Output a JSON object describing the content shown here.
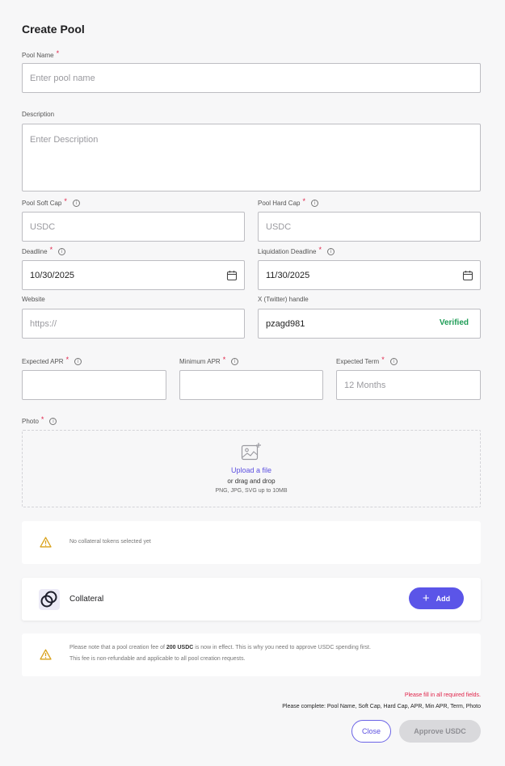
{
  "page": {
    "title": "Create Pool"
  },
  "form": {
    "pool_name": {
      "label": "Pool Name",
      "required_mark": "*",
      "placeholder": "Enter pool name"
    },
    "description": {
      "label": "Description",
      "placeholder": "Enter Description"
    },
    "soft_cap": {
      "label": "Pool Soft Cap",
      "required_mark": "*",
      "placeholder": "USDC",
      "info_icon": "info-icon"
    },
    "hard_cap": {
      "label": "Pool Hard Cap",
      "required_mark": "*",
      "placeholder": "USDC",
      "info_icon": "info-icon"
    },
    "deadline": {
      "label": "Deadline",
      "required_mark": "*",
      "value": "10/30/2025",
      "icon": "calendar-icon"
    },
    "liquidation_deadline": {
      "label": "Liquidation Deadline",
      "required_mark": "*",
      "value": "11/30/2025",
      "icon": "calendar-icon"
    },
    "website": {
      "label": "Website",
      "placeholder": "https://"
    },
    "twitter": {
      "label": "X (Twitter) handle",
      "value": "pzagd981",
      "status": "Verified"
    },
    "expected_apr": {
      "label": "Expected APR",
      "required_mark": "*",
      "value": ""
    },
    "minimum_apr": {
      "label": "Minimum APR",
      "required_mark": "*",
      "value": ""
    },
    "expected_term": {
      "label": "Expected Term",
      "required_mark": "*",
      "placeholder": "12 Months"
    },
    "photo": {
      "label": "Photo",
      "required_mark": "*",
      "upload_link": "Upload a file",
      "drag_text": "or drag and drop",
      "file_types": "PNG, JPG, SVG up to 10MB",
      "icon": "image-add-icon"
    }
  },
  "collateral_warning": {
    "text": "No collateral tokens selected yet",
    "icon": "warning-icon"
  },
  "collateral": {
    "title": "Collateral",
    "add_label": "Add",
    "logo": "collateral-logo"
  },
  "fee_notice": {
    "line1_pre": "Please note that a pool creation fee of ",
    "line1_bold": "200 USDC",
    "line1_post": " is now in effect. This is why you need to approve USDC spending first.",
    "line2": "This fee is non-refundable and applicable to all pool creation requests."
  },
  "validation": {
    "error": "Please fill in all required fields.",
    "missing": "Please complete: Pool Name, Soft Cap, Hard Cap, APR, Min APR, Term, Photo"
  },
  "actions": {
    "close": "Close",
    "approve": "Approve USDC"
  },
  "colors": {
    "accent": "#5b55e8",
    "required": "#e0244a",
    "verified": "#1f9d57",
    "warning": "#d9a21b"
  }
}
